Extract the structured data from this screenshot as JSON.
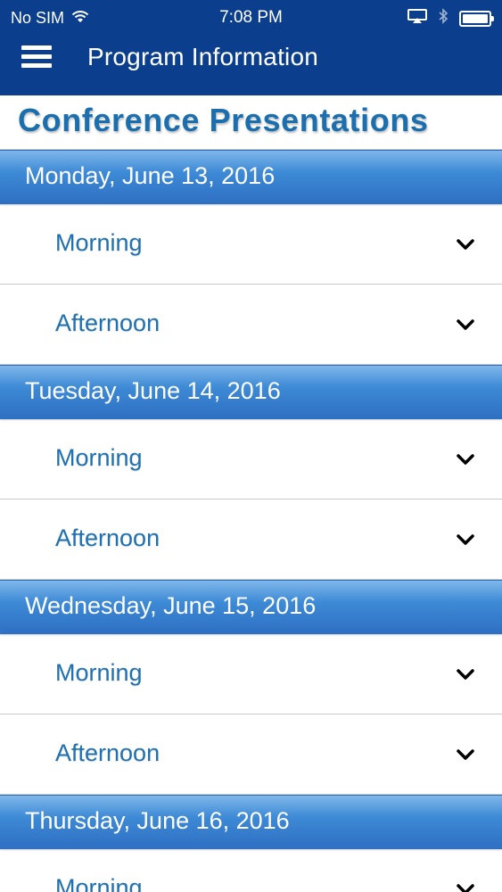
{
  "status_bar": {
    "carrier": "No SIM",
    "time": "7:08 PM"
  },
  "navbar": {
    "title": "Program Information",
    "menu_icon": "hamburger-icon"
  },
  "page": {
    "title": "Conference Presentations"
  },
  "days": [
    {
      "label": "Monday, June 13, 2016",
      "sessions": [
        "Morning",
        "Afternoon"
      ]
    },
    {
      "label": "Tuesday, June 14, 2016",
      "sessions": [
        "Morning",
        "Afternoon"
      ]
    },
    {
      "label": "Wednesday, June 15, 2016",
      "sessions": [
        "Morning",
        "Afternoon"
      ]
    },
    {
      "label": "Thursday, June 16, 2016",
      "sessions": [
        "Morning"
      ]
    }
  ],
  "colors": {
    "header_bg": "#0b3f8e",
    "title_text": "#1c6fae",
    "day_header_bg": "#3d8ad6",
    "session_text": "#1f71b1"
  }
}
